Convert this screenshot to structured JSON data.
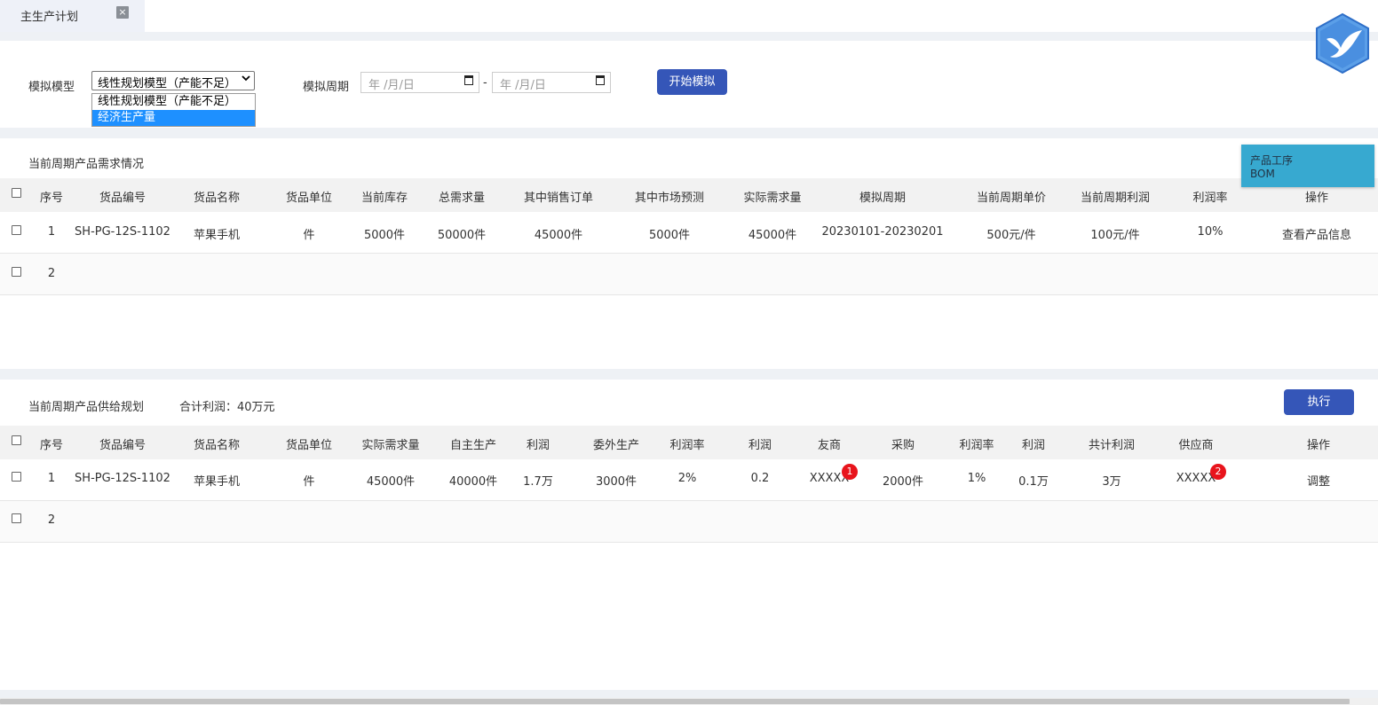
{
  "tab": {
    "label": "主生产计划",
    "close": "×"
  },
  "sim": {
    "model_label": "模拟模型",
    "model_selected": "线性规划模型（产能不足）",
    "model_options": [
      "线性规划模型（产能不足）",
      "经济生产量"
    ],
    "period_label": "模拟周期",
    "date_placeholder": "年 /月/日",
    "date_sep": "-",
    "start_button": "开始模拟"
  },
  "side_menu": {
    "item1": "产品工序",
    "item2": "BOM"
  },
  "demand": {
    "title": "当前周期产品需求情况",
    "headers": [
      "序号",
      "货品编号",
      "货品名称",
      "货品单位",
      "当前库存",
      "总需求量",
      "其中销售订单",
      "其中市场预测",
      "实际需求量",
      "模拟周期",
      "当前周期单价",
      "当前周期利润",
      "利润率",
      "操作"
    ],
    "rows": [
      [
        "1",
        "SH-PG-12S-1102",
        "苹果手机",
        "件",
        "5000件",
        "50000件",
        "45000件",
        "5000件",
        "45000件",
        "20230101-20230201",
        "500元/件",
        "100元/件",
        "10%",
        "查看产品信息"
      ],
      [
        "2",
        "",
        "",
        "",
        "",
        "",
        "",
        "",
        "",
        "",
        "",
        "",
        "",
        ""
      ]
    ]
  },
  "supply": {
    "title": "当前周期产品供给规划",
    "total_profit": "合计利润：40万元",
    "execute_button": "执行",
    "headers": [
      "序号",
      "货品编号",
      "货品名称",
      "货品单位",
      "实际需求量",
      "自主生产",
      "利润",
      "委外生产",
      "利润率",
      "利润",
      "友商",
      "采购",
      "利润率",
      "利润",
      "共计利润",
      "供应商",
      "操作"
    ],
    "rows": [
      [
        "1",
        "SH-PG-12S-1102",
        "苹果手机",
        "件",
        "45000件",
        "40000件",
        "1.7万",
        "3000件",
        "2%",
        "0.2",
        "XXXXX",
        "2000件",
        "1%",
        "0.1万",
        "3万",
        "XXXXX",
        "调整"
      ],
      [
        "2",
        "",
        "",
        "",
        "",
        "",
        "",
        "",
        "",
        "",
        "",
        "",
        "",
        "",
        "",
        "",
        ""
      ]
    ],
    "badge_partner": "1",
    "badge_supplier": "2"
  },
  "colors": {
    "primary": "#3556b8",
    "accent": "#37a9d0",
    "badge": "#e8141c",
    "selection": "#1e90ff"
  }
}
